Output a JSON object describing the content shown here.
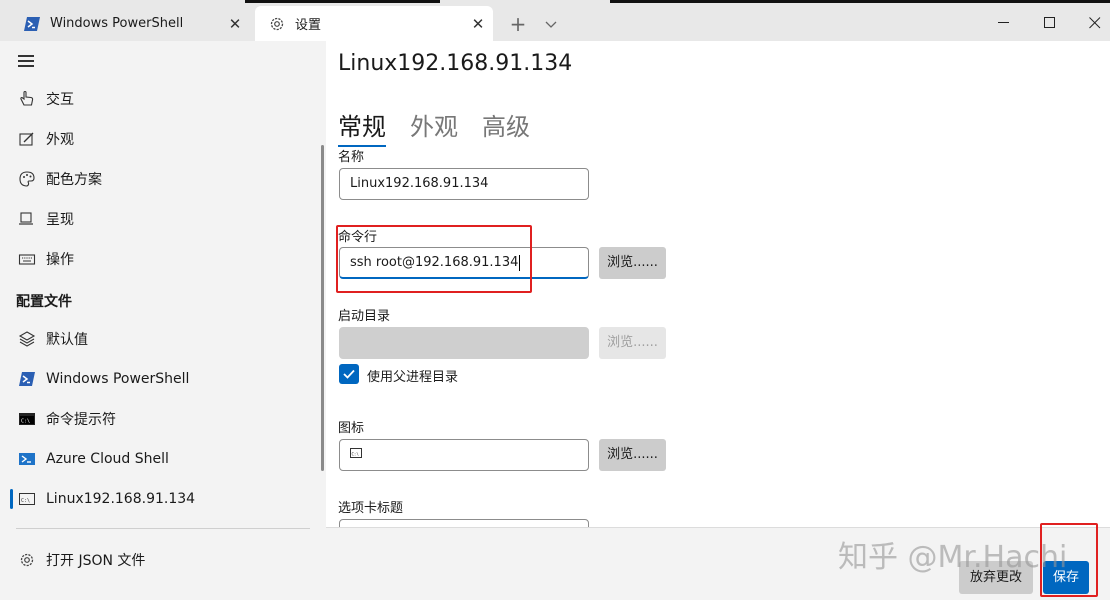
{
  "tabs": {
    "inactive_label": "Windows PowerShell",
    "active_label": "设置"
  },
  "sidebar": {
    "nav_items": [
      {
        "label": "交互",
        "icon": "interaction-icon"
      },
      {
        "label": "外观",
        "icon": "appearance-icon"
      },
      {
        "label": "配色方案",
        "icon": "palette-icon"
      },
      {
        "label": "呈现",
        "icon": "rendering-icon"
      },
      {
        "label": "操作",
        "icon": "keyboard-icon"
      }
    ],
    "profiles_header": "配置文件",
    "profiles": [
      {
        "label": "默认值",
        "icon": "layers-icon"
      },
      {
        "label": "Windows PowerShell",
        "icon": "powershell-icon"
      },
      {
        "label": "命令提示符",
        "icon": "cmd-icon"
      },
      {
        "label": "Azure Cloud Shell",
        "icon": "azure-icon"
      },
      {
        "label": "Linux192.168.91.134",
        "icon": "terminal-icon"
      }
    ],
    "open_json": "打开 JSON 文件"
  },
  "main": {
    "profile_title": "Linux192.168.91.134",
    "tabs": [
      "常规",
      "外观",
      "高级"
    ],
    "name_label": "名称",
    "name_value": "Linux192.168.91.134",
    "cmd_label": "命令行",
    "cmd_value": "ssh root@192.168.91.134",
    "browse_label": "浏览......",
    "startdir_label": "启动目录",
    "startdir_value": "",
    "use_parent_label": "使用父进程目录",
    "icon_label": "图标",
    "tab_title_label": "选项卡标题"
  },
  "footer": {
    "discard": "放弃更改",
    "save": "保存",
    "watermark": "知乎 @Mr.Hachi"
  },
  "colors": {
    "accent": "#0067c0",
    "highlight": "#e02020"
  }
}
